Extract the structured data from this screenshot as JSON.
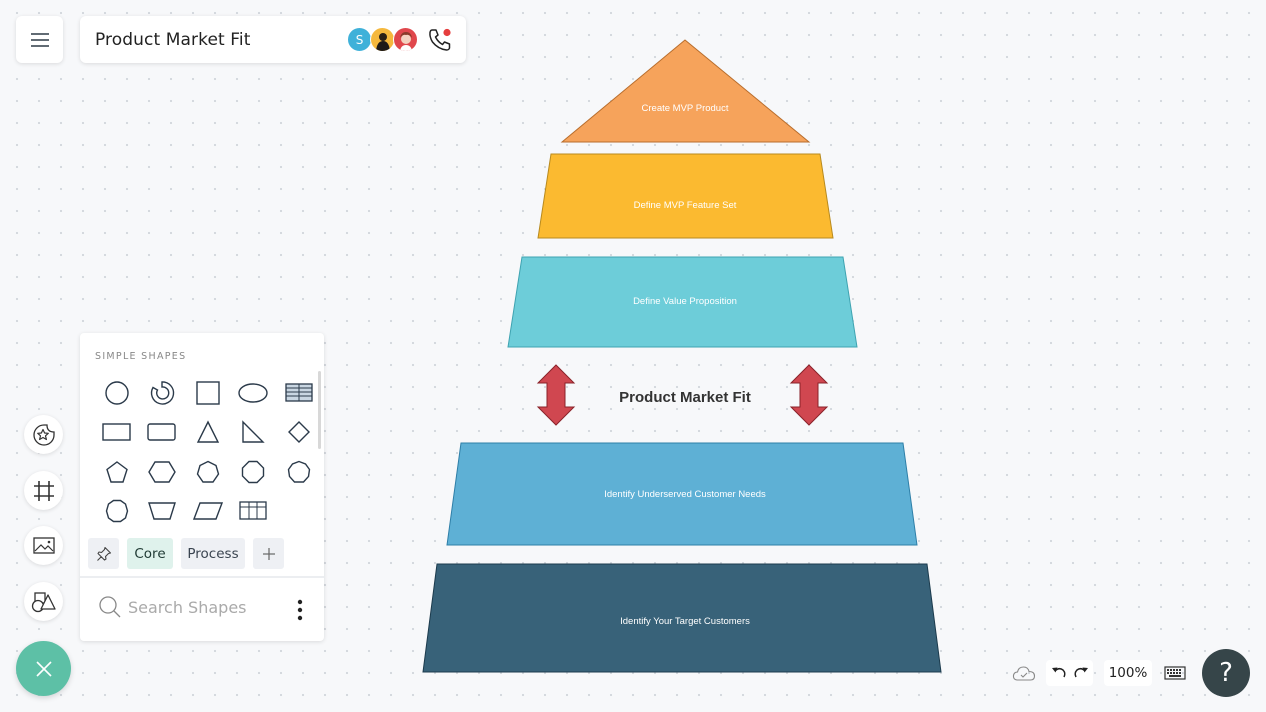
{
  "header": {
    "menu_icon": "hamburger-icon",
    "title": "Product Market Fit",
    "collaborators": [
      {
        "initial": "S",
        "color": "#3fb1d9"
      },
      {
        "initial": "",
        "color": "#f5b83d"
      },
      {
        "initial": "",
        "color": "#e0474c"
      }
    ],
    "call_icon": "phone-icon",
    "call_indicator_color": "#e53e3e"
  },
  "left_rail": {
    "buttons": [
      {
        "name": "stickers",
        "icon": "star-sticker-icon"
      },
      {
        "name": "frame",
        "icon": "frame-grid-icon"
      },
      {
        "name": "image",
        "icon": "image-icon"
      },
      {
        "name": "shapes",
        "icon": "shapes-icon"
      }
    ],
    "close_icon": "close-icon"
  },
  "shapes_panel": {
    "section_label": "SIMPLE SHAPES",
    "shapes": [
      "circle",
      "arc",
      "square",
      "ellipse",
      "table",
      "rectangle",
      "rounded-rectangle",
      "triangle",
      "right-triangle",
      "diamond",
      "pentagon",
      "hexagon",
      "heptagon",
      "octagon",
      "nonagon",
      "decagon",
      "trapezoid",
      "parallelogram",
      "grid-table"
    ],
    "tabs": [
      {
        "label": "",
        "icon": "pin-icon"
      },
      {
        "label": "Core",
        "active": true
      },
      {
        "label": "Process",
        "active": false
      },
      {
        "label": "",
        "icon": "plus-icon"
      }
    ],
    "search_placeholder": "Search Shapes"
  },
  "diagram": {
    "levels": [
      {
        "label": "Create MVP Product",
        "fill": "#f6a35b",
        "stroke": "#b86d2c"
      },
      {
        "label": "Define MVP Feature Set",
        "fill": "#fbba30",
        "stroke": "#b88a1e"
      },
      {
        "label": "Define Value Proposition",
        "fill": "#6dcdd9",
        "stroke": "#3ea3b1"
      },
      {
        "label": "Identify Underserved Customer Needs",
        "fill": "#5eb0d5",
        "stroke": "#2e7fa8"
      },
      {
        "label": "Identify Your Target Customers",
        "fill": "#386279",
        "stroke": "#1c3b4d"
      }
    ],
    "center_label": "Product Market Fit",
    "arrow_fill": "#d04750",
    "arrow_stroke": "#8a2229"
  },
  "footer": {
    "save_status_icon": "cloud-check-icon",
    "undo_icon": "undo-icon",
    "redo_icon": "redo-icon",
    "zoom_level": "100%",
    "keyboard_icon": "keyboard-icon",
    "help_label": "?"
  }
}
